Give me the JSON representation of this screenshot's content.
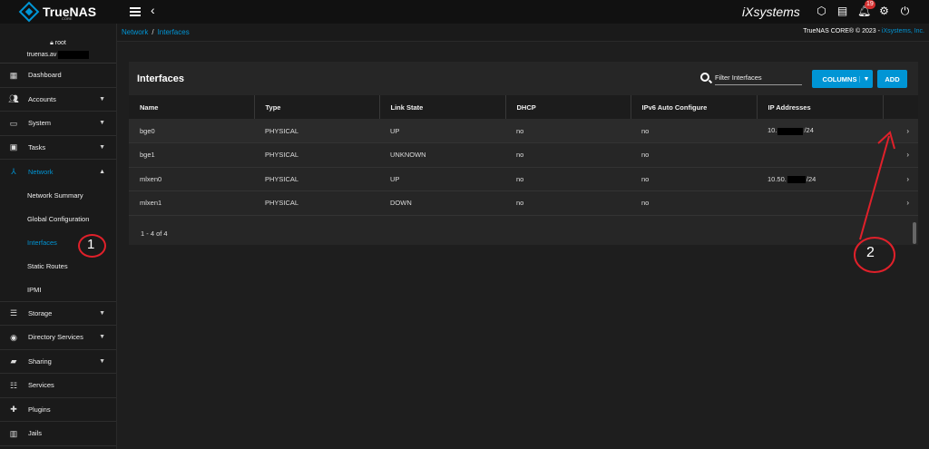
{
  "app": {
    "logo_text": "TrueNAS",
    "logo_sub": "CORE",
    "brand": "iXsystems",
    "notification_count": "19"
  },
  "user": {
    "name": "root",
    "host": "truenas.av"
  },
  "sidebar": {
    "items": [
      {
        "label": "Dashboard",
        "icon": "dashboard-icon"
      },
      {
        "label": "Accounts",
        "icon": "people-icon"
      },
      {
        "label": "System",
        "icon": "laptop-icon"
      },
      {
        "label": "Tasks",
        "icon": "calendar-icon"
      },
      {
        "label": "Network",
        "icon": "network-icon"
      },
      {
        "label": "Storage",
        "icon": "storage-icon"
      },
      {
        "label": "Directory Services",
        "icon": "directory-icon"
      },
      {
        "label": "Sharing",
        "icon": "folder-share-icon"
      },
      {
        "label": "Services",
        "icon": "tune-icon"
      },
      {
        "label": "Plugins",
        "icon": "puzzle-icon"
      },
      {
        "label": "Jails",
        "icon": "jail-icon"
      }
    ],
    "network_sub": [
      {
        "label": "Network Summary"
      },
      {
        "label": "Global Configuration"
      },
      {
        "label": "Interfaces"
      },
      {
        "label": "Static Routes"
      },
      {
        "label": "IPMI"
      }
    ]
  },
  "breadcrumb": {
    "parent": "Network",
    "sep": "/",
    "current": "Interfaces"
  },
  "copyright": {
    "text": "TrueNAS CORE® © 2023 - ",
    "link": "iXsystems, Inc."
  },
  "card": {
    "title": "Interfaces",
    "filter_placeholder": "Filter Interfaces",
    "columns_label": "COLUMNS",
    "add_label": "ADD",
    "pager": "1 - 4 of 4"
  },
  "table": {
    "headers": [
      "Name",
      "Type",
      "Link State",
      "DHCP",
      "IPv6 Auto Configure",
      "IP Addresses"
    ],
    "rows": [
      {
        "name": "bge0",
        "type": "PHYSICAL",
        "link": "UP",
        "dhcp": "no",
        "ipv6": "no",
        "ip_a": "10.",
        "ip_b": "/24"
      },
      {
        "name": "bge1",
        "type": "PHYSICAL",
        "link": "UNKNOWN",
        "dhcp": "no",
        "ipv6": "no",
        "ip_a": "",
        "ip_b": ""
      },
      {
        "name": "mlxen0",
        "type": "PHYSICAL",
        "link": "UP",
        "dhcp": "no",
        "ipv6": "no",
        "ip_a": "10.50.",
        "ip_b": "/24"
      },
      {
        "name": "mlxen1",
        "type": "PHYSICAL",
        "link": "DOWN",
        "dhcp": "no",
        "ipv6": "no",
        "ip_a": "",
        "ip_b": ""
      }
    ]
  },
  "annotations": {
    "one": "1",
    "two": "2"
  },
  "colors": {
    "accent": "#0095d5",
    "annotation": "#e0202a"
  }
}
